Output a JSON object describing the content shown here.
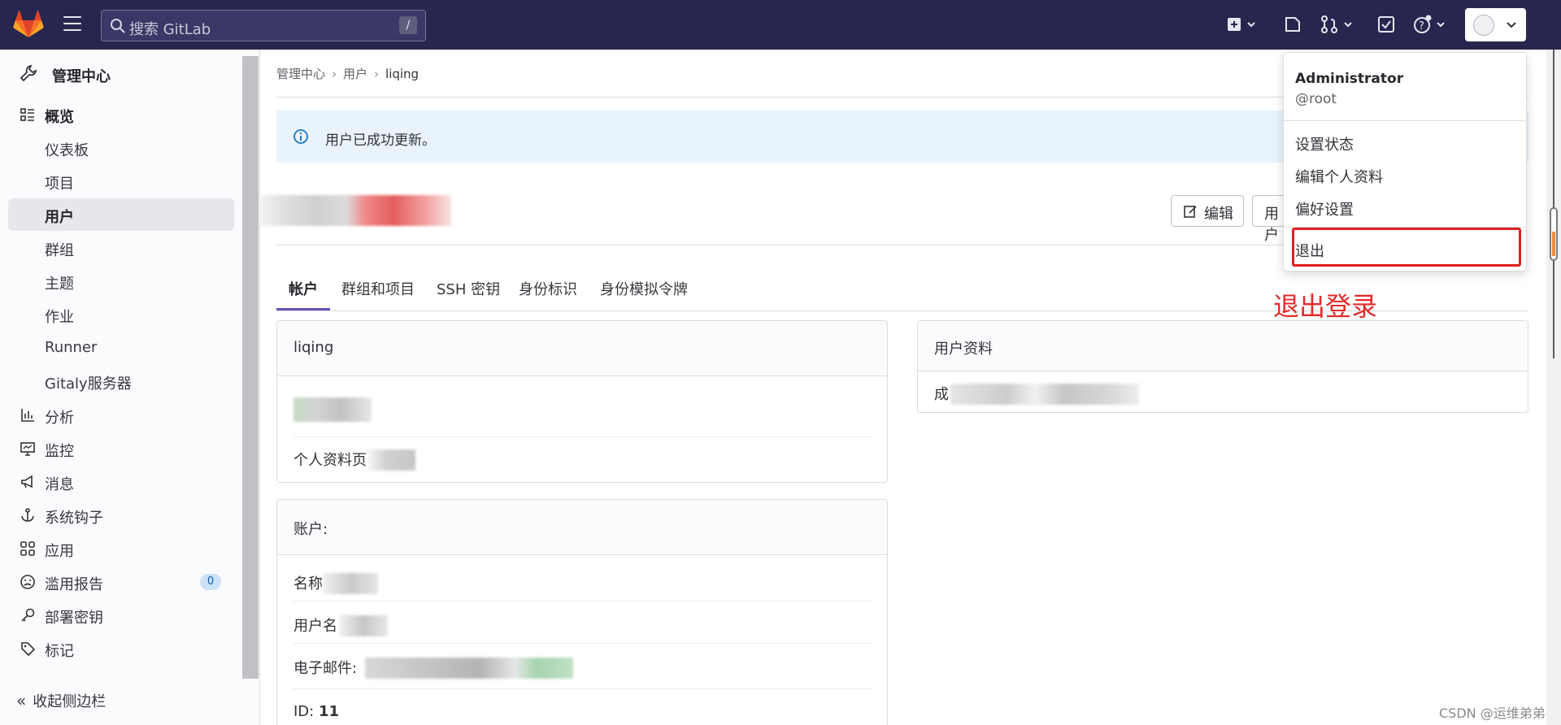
{
  "topbar": {
    "search_placeholder": "搜索 GitLab",
    "search_shortcut": "/"
  },
  "sidebar": {
    "header": "管理中心",
    "items": [
      {
        "label": "概览",
        "icon": "overview-icon"
      },
      {
        "label": "仪表板"
      },
      {
        "label": "项目"
      },
      {
        "label": "用户"
      },
      {
        "label": "群组"
      },
      {
        "label": "主题"
      },
      {
        "label": "作业"
      },
      {
        "label": "Runner"
      },
      {
        "label": "Gitaly服务器"
      },
      {
        "label": "分析",
        "icon": "chart-icon"
      },
      {
        "label": "监控",
        "icon": "monitor-icon"
      },
      {
        "label": "消息",
        "icon": "megaphone-icon"
      },
      {
        "label": "系统钩子",
        "icon": "anchor-icon"
      },
      {
        "label": "应用",
        "icon": "apps-icon"
      },
      {
        "label": "滥用报告",
        "icon": "abuse-icon",
        "badge": "0"
      },
      {
        "label": "部署密钥",
        "icon": "key-icon"
      },
      {
        "label": "标记",
        "icon": "label-icon"
      }
    ],
    "collapse_label": "收起侧边栏"
  },
  "breadcrumb": {
    "items": [
      "管理中心",
      "用户"
    ],
    "current": "liqing"
  },
  "alert": {
    "message": "用户已成功更新。"
  },
  "actions": {
    "edit_label": "编辑",
    "other_label": "用户"
  },
  "tabs": [
    "帐户",
    "群组和项目",
    "SSH 密钥",
    "身份标识",
    "身份模拟令牌"
  ],
  "profile_card": {
    "title": "liqing",
    "profile_page_label": "个人资料页"
  },
  "account_card": {
    "title": "账户:",
    "name_label": "名称",
    "username_label": "用户名",
    "email_label": "电子邮件:",
    "id_label": "ID:",
    "id_value": "11"
  },
  "user_info_card": {
    "title": "用户资料",
    "row_label": "成"
  },
  "user_menu": {
    "name": "Administrator",
    "username": "@root",
    "items": [
      "设置状态",
      "编辑个人资料",
      "偏好设置"
    ],
    "sign_out": "退出"
  },
  "annotation": "退出登录",
  "watermark": "CSDN @运维弟弟",
  "colors": {
    "topbar": "#28264f",
    "accent": "#6b4fbb",
    "alert_bg": "#e9f3fc",
    "highlight": "#e02020"
  }
}
